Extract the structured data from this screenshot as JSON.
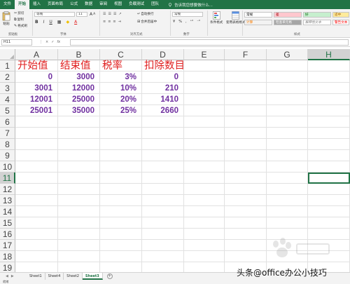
{
  "menu": {
    "items": [
      "文件",
      "开始",
      "插入",
      "页面布局",
      "公式",
      "数据",
      "审阅",
      "视图",
      "负载测试",
      "团队"
    ],
    "active_index": 1,
    "tell_me": "告诉我您想要做什么..."
  },
  "ribbon": {
    "clipboard": {
      "paste": "粘贴",
      "cut": "剪切",
      "copy": "复制",
      "format_painter": "格式刷",
      "label": "剪贴板"
    },
    "font": {
      "name": "等线",
      "size": "11",
      "bold": "B",
      "italic": "I",
      "underline": "U",
      "label": "字体"
    },
    "alignment": {
      "wrap": "自动换行",
      "merge": "合并后居中",
      "label": "对齐方式"
    },
    "number": {
      "format": "常规",
      "percent": "%",
      "comma": ",",
      "label": "数字"
    },
    "conditional": "条件格式",
    "table_format": "套用表格格式",
    "styles": {
      "label": "样式",
      "items": [
        {
          "name": "常规",
          "bg": "#ffffff",
          "fg": "#000000"
        },
        {
          "name": "差",
          "bg": "#ffc7ce",
          "fg": "#9c0006"
        },
        {
          "name": "好",
          "bg": "#c6efce",
          "fg": "#006100"
        },
        {
          "name": "适中",
          "bg": "#ffeb9c",
          "fg": "#9c5700"
        },
        {
          "name": "计算",
          "bg": "#f2f2f2",
          "fg": "#fa7d00"
        },
        {
          "name": "检查单元格",
          "bg": "#a5a5a5",
          "fg": "#ffffff"
        },
        {
          "name": "解释性文本",
          "bg": "#ffffff",
          "fg": "#7f7f7f"
        },
        {
          "name": "警告文本",
          "bg": "#ffffff",
          "fg": "#ff0000"
        }
      ]
    }
  },
  "formula_bar": {
    "name_box": "H11",
    "cancel": "×",
    "enter": "✓",
    "fx": "fx",
    "value": ""
  },
  "columns": [
    "A",
    "B",
    "C",
    "D",
    "E",
    "F",
    "G",
    "H"
  ],
  "selected_column": "H",
  "selected_row": 11,
  "rows": [
    "1",
    "2",
    "3",
    "4",
    "5",
    "6",
    "7",
    "8",
    "9",
    "10",
    "11",
    "12",
    "13",
    "14",
    "15",
    "16",
    "17",
    "18",
    "19"
  ],
  "table": {
    "headers": [
      "开始值",
      "结束值",
      "税率",
      "扣除数目"
    ],
    "data": [
      [
        "0",
        "3000",
        "3%",
        "0"
      ],
      [
        "3001",
        "12000",
        "10%",
        "210"
      ],
      [
        "12001",
        "25000",
        "20%",
        "1410"
      ],
      [
        "25001",
        "35000",
        "25%",
        "2660"
      ]
    ]
  },
  "sheets": {
    "tabs": [
      "Sheet1",
      "Sheet4",
      "Sheet2",
      "Sheet3"
    ],
    "active_index": 3,
    "add": "+"
  },
  "status": "就绪",
  "watermark": "头条@office办公小技巧",
  "colors": {
    "accent": "#217346",
    "header_text": "#e01e1e",
    "number_text": "#7030a0"
  }
}
